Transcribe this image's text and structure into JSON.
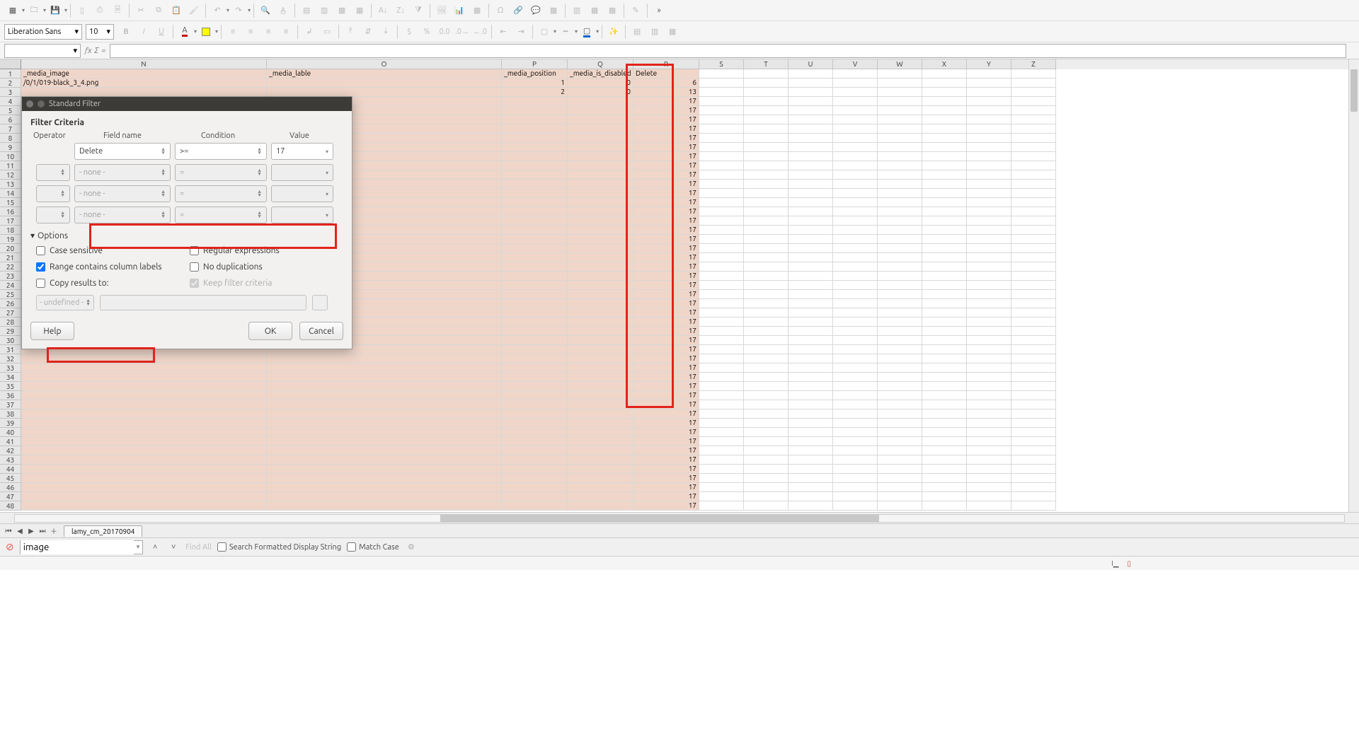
{
  "toolbar": {
    "font_name": "Liberation Sans",
    "font_size": "10",
    "more_icon": "»"
  },
  "formula_bar": {
    "name_box": "",
    "fx": "fx",
    "sigma": "Σ",
    "eq": "="
  },
  "columns": [
    "N",
    "O",
    "P",
    "Q",
    "R",
    "S",
    "T",
    "U",
    "V",
    "W",
    "X",
    "Y",
    "Z"
  ],
  "headers": {
    "N": "_media_image",
    "O": "_media_lable",
    "P": "_media_position",
    "Q": "_media_is_disabled",
    "R": "Delete"
  },
  "rows_visible": 48,
  "data_rows": [
    {
      "N": "/0/1/019-black_3_4.png",
      "P": "1",
      "Q": "0",
      "R": "6"
    },
    {
      "P": "2",
      "Q": "0",
      "R": "13"
    }
  ],
  "r_default": "17",
  "selected_col_end": "R",
  "sheet_tab_name": "lamy_cm_20170904",
  "find": {
    "text": "image",
    "find_all": "Find All",
    "opt_sfds": "Search Formatted Display String",
    "opt_matchcase": "Match Case"
  },
  "status": {
    "zoom": "",
    "lang": "I",
    "insert": ""
  },
  "dialog": {
    "title": "Standard Filter",
    "section": "Filter Criteria",
    "heads": {
      "op": "Operator",
      "field": "Field name",
      "cond": "Condition",
      "val": "Value"
    },
    "rows": [
      {
        "op": "",
        "field": "Delete",
        "cond": ">=",
        "val": "17",
        "disabled": false
      },
      {
        "op": "",
        "field": "- none -",
        "cond": "=",
        "val": "",
        "disabled": true
      },
      {
        "op": "",
        "field": "- none -",
        "cond": "=",
        "val": "",
        "disabled": true
      },
      {
        "op": "",
        "field": "- none -",
        "cond": "=",
        "val": "",
        "disabled": true
      }
    ],
    "options_label": "Options",
    "case_sensitive": "Case sensitive",
    "regex": "Regular expressions",
    "range_labels": "Range contains column labels",
    "no_dup": "No duplications",
    "copy_to": "Copy results to:",
    "keep_filter": "Keep filter criteria",
    "copy_target": "- undefined -",
    "help": "Help",
    "ok": "OK",
    "cancel": "Cancel"
  }
}
